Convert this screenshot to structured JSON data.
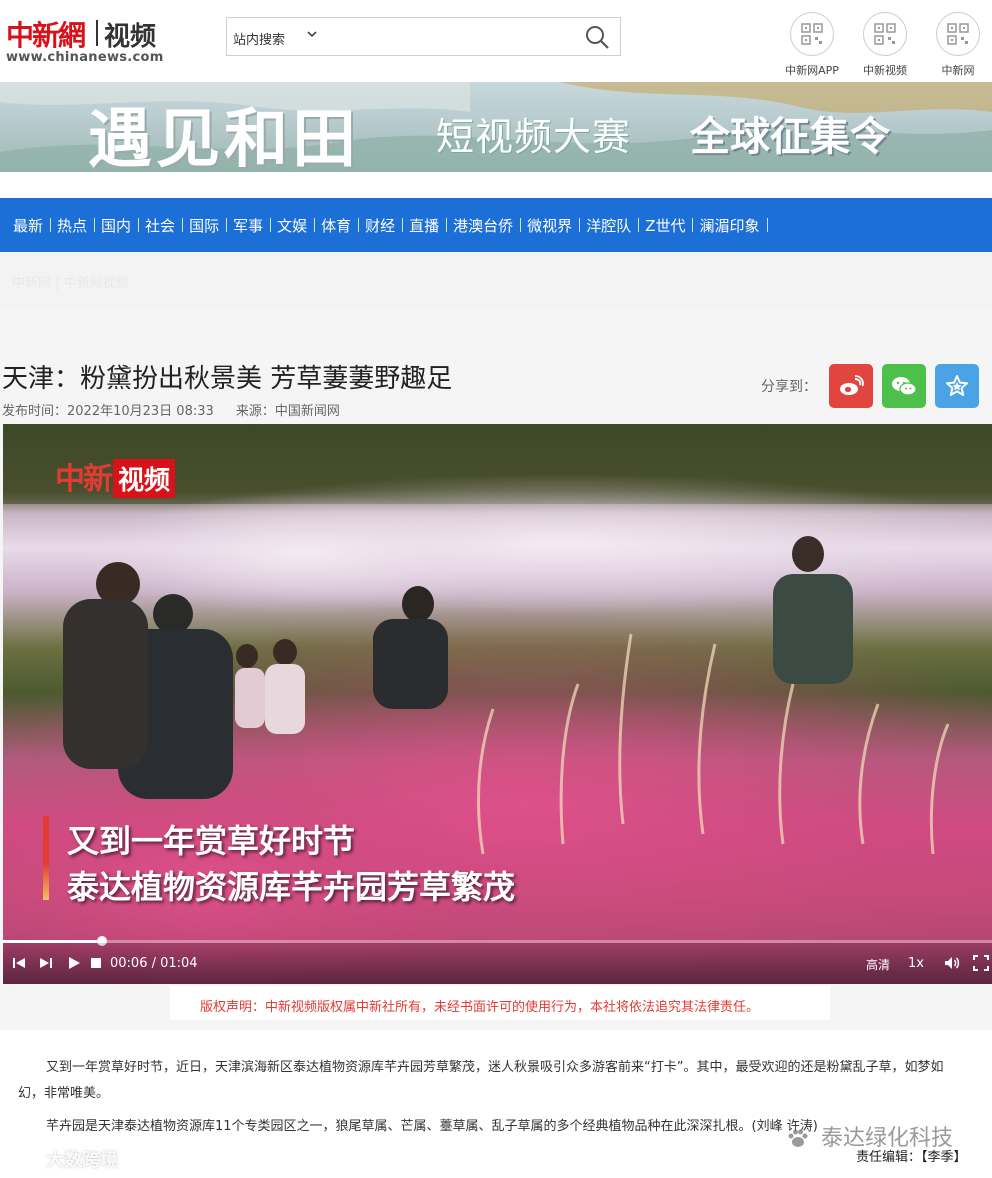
{
  "header": {
    "logo_cn": "中新網",
    "logo_video": "视频",
    "logo_url": "www.chinanews.com",
    "search": {
      "scope": "站内搜索",
      "value": "",
      "placeholder": ""
    },
    "qr_links": [
      {
        "label": "中新网APP",
        "icon": "qr-code-icon"
      },
      {
        "label": "中新视频",
        "icon": "qr-code-icon"
      },
      {
        "label": "中新网",
        "icon": "qr-code-icon"
      }
    ]
  },
  "banner": {
    "title": "遇见和田",
    "subtitle": "短视频大赛",
    "tagline": "全球征集令"
  },
  "nav": {
    "items": [
      "最新",
      "热点",
      "国内",
      "社会",
      "国际",
      "军事",
      "文娱",
      "体育",
      "财经",
      "直播",
      "港澳台侨",
      "微视界",
      "洋腔队",
      "Z世代",
      "澜湄印象"
    ]
  },
  "breadcrumb": {
    "home": "中新网",
    "section": "中新网视频"
  },
  "article": {
    "title": "天津：粉黛扮出秋景美 芳草萋萋野趣足",
    "publish_time": "发布时间：2022年10月23日 08:33",
    "source": "来源：中国新闻网",
    "share_label": "分享到：",
    "share": [
      {
        "name": "weibo",
        "icon": "weibo-icon",
        "color": "#e2453e"
      },
      {
        "name": "wechat",
        "icon": "wechat-icon",
        "color": "#4cc04a"
      },
      {
        "name": "favorite",
        "icon": "star-icon",
        "color": "#4aa3e4"
      }
    ]
  },
  "video": {
    "logo_text": "中新",
    "logo_box": "视频",
    "caption_line1": "又到一年赏草好时节",
    "caption_line2": "泰达植物资源库芊卉园芳草繁茂",
    "time_display": "00:06 / 01:04",
    "progress_fraction": 0.1,
    "quality": "高清",
    "speed": "1x"
  },
  "copyright": "版权声明：中新视频版权属中新社所有，未经书面许可的使用行为，本社将依法追究其法律责任。",
  "body": {
    "paragraph1": "又到一年赏草好时节，近日，天津滨海新区泰达植物资源库芊卉园芳草繁茂，迷人秋景吸引众多游客前来“打卡”。其中，最受欢迎的还是粉黛乱子草，如梦如幻，非常唯美。",
    "paragraph2": "芊卉园是天津泰达植物资源库11个专类园区之一，狼尾草属、芒属、薹草属、乱子草属的多个经典植物品种在此深深扎根。(刘峰 许涛)"
  },
  "editor": "责任编辑：【李季】",
  "watermarks": {
    "left": "大数跨境",
    "right": "泰达绿化科技"
  }
}
